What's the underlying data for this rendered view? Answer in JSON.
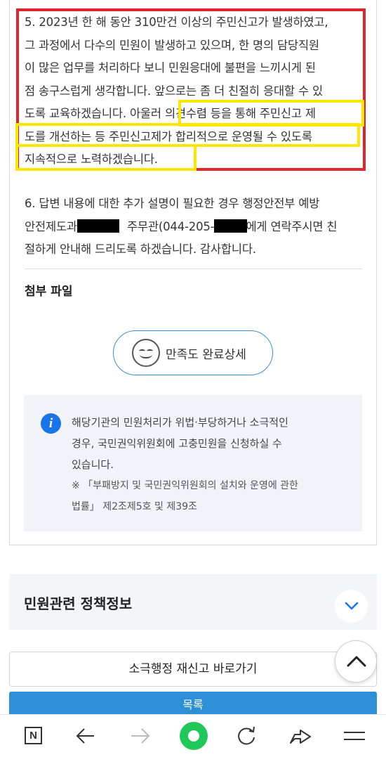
{
  "answer": {
    "para5_lines": [
      "5. 2023년 한 해 동안 310만건 이상의 주민신고가 발생하였고,",
      "그 과정에서 다수의 민원이 발생하고 있으며, 한 명의 담당직원",
      "이 많은 업무를 처리하다 보니 민원응대에 불편을 느끼시게 된",
      "점 송구스럽게 생각합니다. 앞으로는 좀 더 친절히 응대할 수 있",
      "도록 교육하겠습니다. 아울러 의견수렴 등을 통해 주민신고 제",
      "도를 개선하는 등 주민신고제가 합리적으로 운영될 수 있도록",
      "지속적으로 노력하겠습니다."
    ],
    "para6_line1": "6. 답변 내용에 대한 추가 설명이 필요한 경우 행정안전부 예방",
    "para6_line2a": "안전제도과",
    "para6_line2b": " 주무관(044-205-",
    "para6_line2c": "에게 연락주시면 친",
    "para6_line3": "절하게 안내해 드리도록 하겠습니다. 감사합니다."
  },
  "attachments": {
    "title": "첨부 파일"
  },
  "satisfaction": {
    "label": "만족도 완료상세",
    "icon": "smiley-icon"
  },
  "notice": {
    "icon": "info-icon",
    "lines": [
      "해당기관의 민원처리가 위법·부당하거나 소극적인",
      "경우, 국민권익위원회에 고충민원을 신청하실 수",
      "있습니다."
    ],
    "law_lines": [
      "※ 「부패방지 및 국민권익위원회의 설치와 운영에 관한",
      "법률」 제2조제5호 및 제39조"
    ]
  },
  "policy": {
    "title": "민원관련 정책정보"
  },
  "report_button": {
    "label": "소극행정 재신고 바로가기"
  },
  "list_button": {
    "label": "목록"
  },
  "browser_nav": {
    "items": [
      "naver-n-icon",
      "back-arrow-icon",
      "forward-arrow-icon",
      "home-icon",
      "refresh-icon",
      "share-icon",
      "menu-icon"
    ],
    "n_label": "N"
  },
  "colors": {
    "annotation_red": "#e0262c",
    "annotation_yellow": "#ffe600",
    "primary_blue": "#2d8fd5",
    "info_blue": "#1a73e8",
    "home_green": "#20c85a"
  }
}
